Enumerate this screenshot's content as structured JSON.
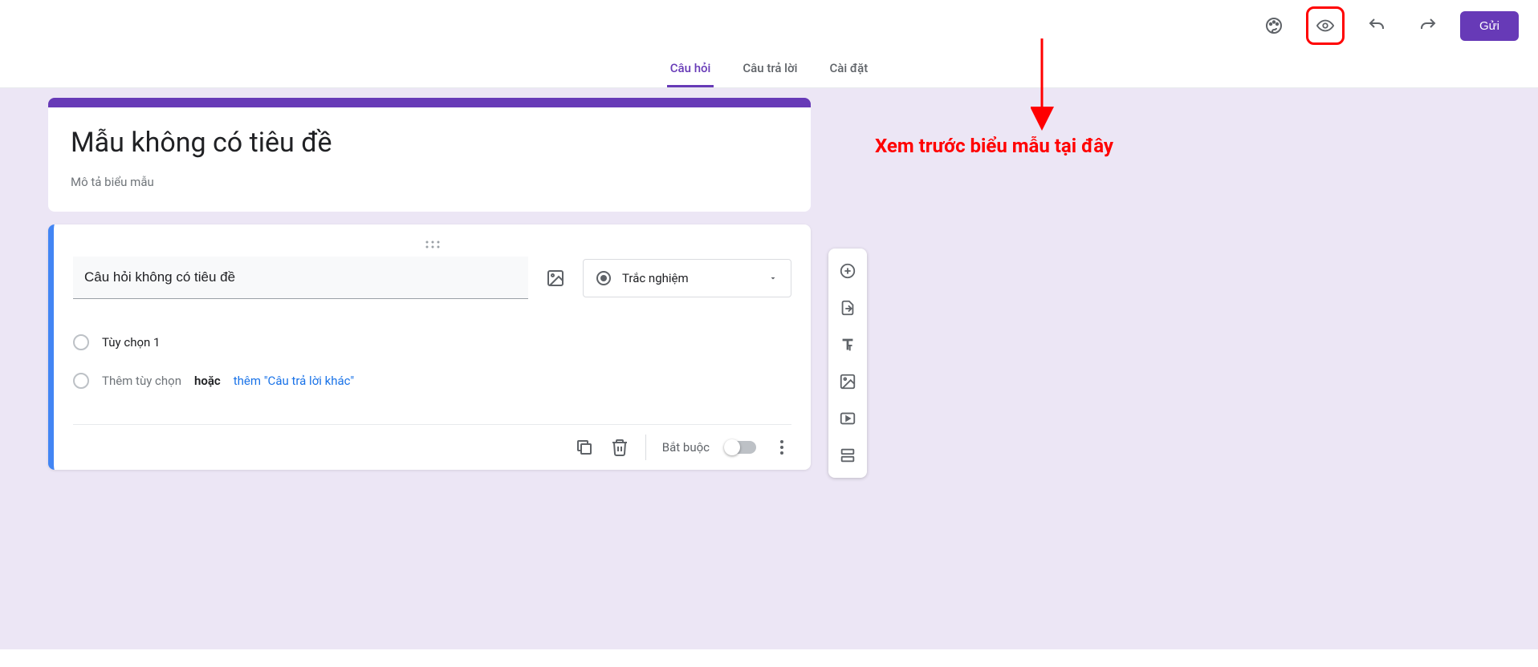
{
  "header": {
    "send_label": "Gửi"
  },
  "tabs": {
    "questions": "Câu hỏi",
    "responses": "Câu trả lời",
    "settings": "Cài đặt"
  },
  "title_card": {
    "title": "Mẫu không có tiêu đề",
    "description": "Mô tả biểu mẫu"
  },
  "question": {
    "title": "Câu hỏi không có tiêu đề",
    "type_label": "Trắc nghiệm",
    "option1": "Tùy chọn 1",
    "add_option": "Thêm tùy chọn",
    "or_word": "hoặc",
    "add_other": "thêm \"Câu trả lời khác\"",
    "required_label": "Bắt buộc"
  },
  "annotation": {
    "text": "Xem trước biểu mẫu tại đây"
  }
}
